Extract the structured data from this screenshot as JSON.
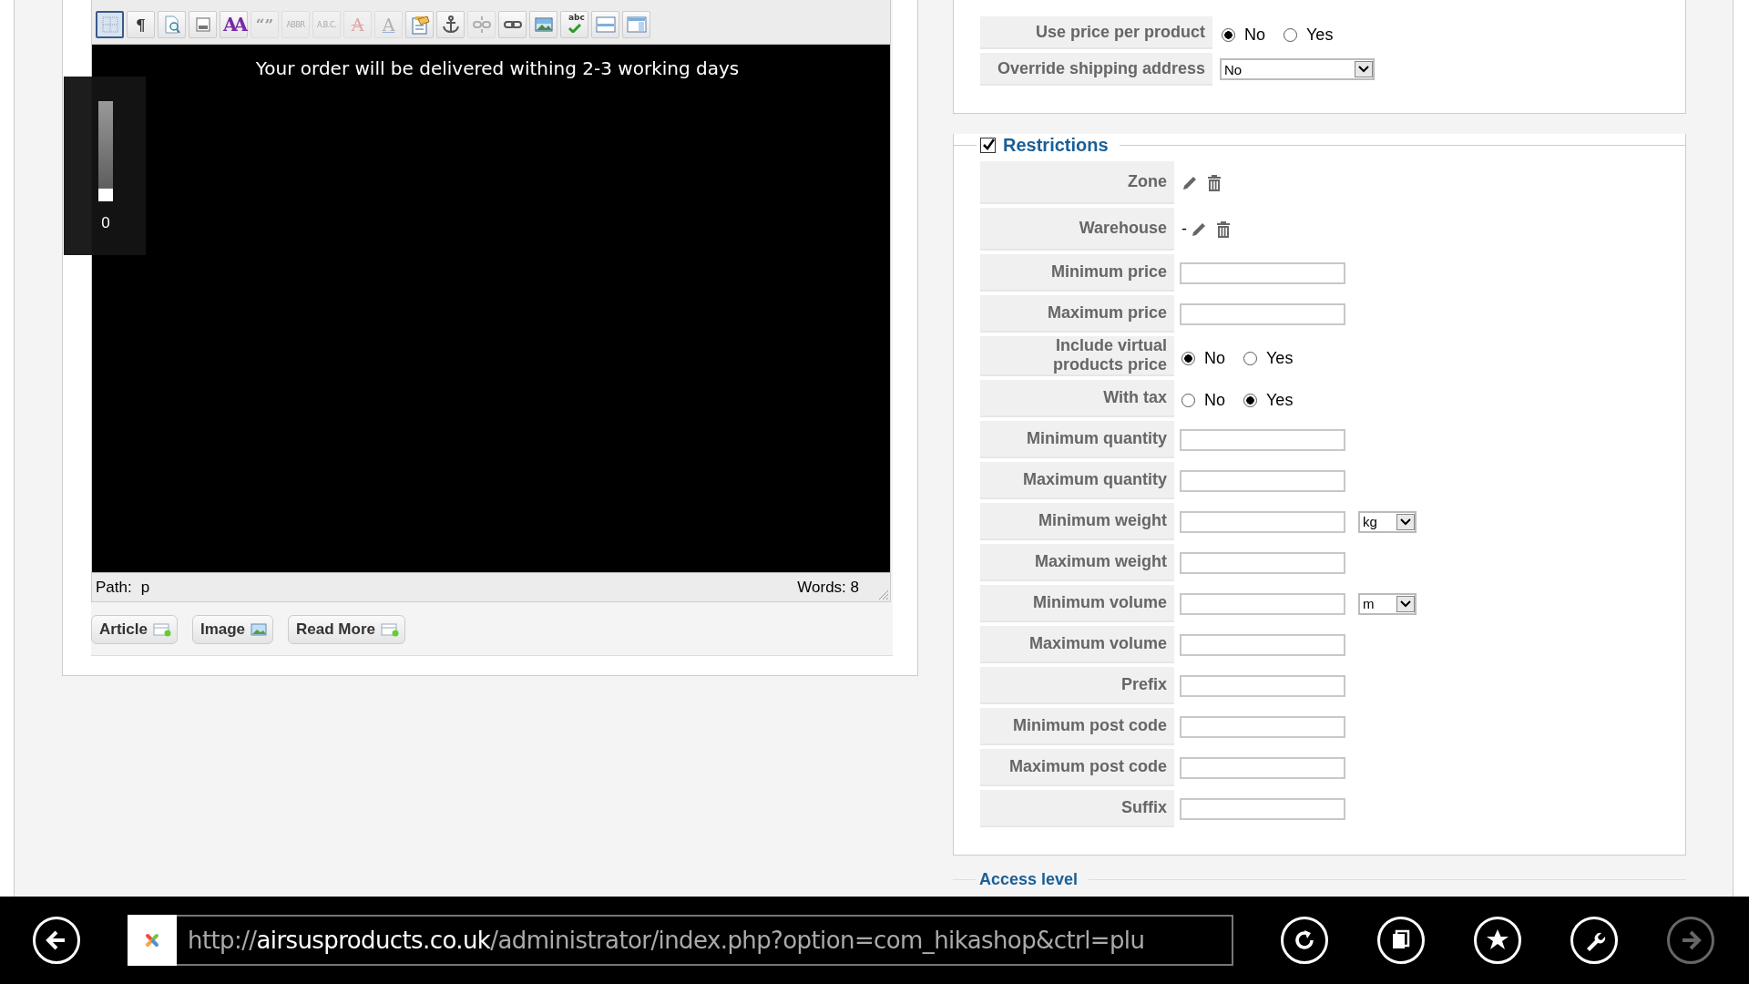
{
  "editor": {
    "toolbar": [
      {
        "kind": "grid",
        "selected": true,
        "disabled": false
      },
      {
        "kind": "glyph",
        "text": "¶",
        "selected": false,
        "disabled": false
      },
      {
        "kind": "preview",
        "selected": false,
        "disabled": false
      },
      {
        "kind": "template",
        "selected": false,
        "disabled": false
      },
      {
        "kind": "styled",
        "text": "AA",
        "selected": false,
        "disabled": false
      },
      {
        "kind": "glyph",
        "text": "“”",
        "selected": false,
        "disabled": true
      },
      {
        "kind": "small",
        "text": "ABBR",
        "selected": false,
        "disabled": true
      },
      {
        "kind": "small",
        "text": "A.B.C.",
        "selected": false,
        "disabled": true
      },
      {
        "kind": "strike",
        "text": "A",
        "selected": false,
        "disabled": true
      },
      {
        "kind": "underline",
        "text": "A",
        "selected": false,
        "disabled": true
      },
      {
        "kind": "paste",
        "selected": false,
        "disabled": false
      },
      {
        "kind": "anchor",
        "selected": false,
        "disabled": false
      },
      {
        "kind": "unlink",
        "selected": false,
        "disabled": true
      },
      {
        "kind": "link",
        "selected": false,
        "disabled": false
      },
      {
        "kind": "image",
        "selected": false,
        "disabled": false
      },
      {
        "kind": "spellcheck",
        "text": "abc",
        "selected": false,
        "disabled": false
      },
      {
        "kind": "rule",
        "selected": false,
        "disabled": false
      },
      {
        "kind": "layout",
        "selected": false,
        "disabled": false
      }
    ],
    "content": "Your order will be delivered withing 2-3 working days",
    "path_label": "Path:",
    "path": "p",
    "words": "Words: 8",
    "buttons": [
      {
        "label": "Article",
        "kind": "page"
      },
      {
        "label": "Image",
        "kind": "image"
      },
      {
        "label": "Read More",
        "kind": "page"
      }
    ]
  },
  "zoom_overlay": {
    "level": 0,
    "value": "0"
  },
  "shipping_options": {
    "rows": [
      {
        "kind": "radio",
        "label": "Use price per product",
        "options": [
          {
            "label": "No",
            "selected": true
          },
          {
            "label": "Yes",
            "selected": false
          }
        ]
      },
      {
        "kind": "select",
        "label": "Override shipping address",
        "value": "No"
      }
    ]
  },
  "restrictions": {
    "title": "Restrictions",
    "checked": true,
    "rows": [
      {
        "kind": "picker",
        "label": "Zone"
      },
      {
        "kind": "picker",
        "label": "Warehouse",
        "value": "-"
      },
      {
        "kind": "input",
        "label": "Minimum price"
      },
      {
        "kind": "input",
        "label": "Maximum price"
      },
      {
        "kind": "radio",
        "label": "Include virtual products price",
        "options": [
          {
            "label": "No",
            "selected": true
          },
          {
            "label": "Yes",
            "selected": false
          }
        ]
      },
      {
        "kind": "radio",
        "label": "With tax",
        "options": [
          {
            "label": "No",
            "selected": false
          },
          {
            "label": "Yes",
            "selected": true
          }
        ]
      },
      {
        "kind": "input",
        "label": "Minimum quantity"
      },
      {
        "kind": "input",
        "label": "Maximum quantity"
      },
      {
        "kind": "input",
        "label": "Minimum weight",
        "unit": "kg"
      },
      {
        "kind": "input",
        "label": "Maximum weight"
      },
      {
        "kind": "input",
        "label": "Minimum volume",
        "unit": "m"
      },
      {
        "kind": "input",
        "label": "Maximum volume"
      },
      {
        "kind": "input",
        "label": "Prefix"
      },
      {
        "kind": "input",
        "label": "Minimum post code"
      },
      {
        "kind": "input",
        "label": "Maximum post code"
      },
      {
        "kind": "input",
        "label": "Suffix"
      }
    ]
  },
  "access_level": {
    "title": "Access level"
  },
  "browser_bar": {
    "url": "http://**airsusproducts.co.uk**/administrator/index.php?option=com_hikashop&ctrl=plu",
    "buttons": [
      {
        "kind": "back",
        "disabled": false
      },
      {
        "kind": "refresh",
        "disabled": false
      },
      {
        "kind": "tabs",
        "disabled": false
      },
      {
        "kind": "star",
        "disabled": false
      },
      {
        "kind": "wrench",
        "disabled": false
      },
      {
        "kind": "forward",
        "disabled": true
      }
    ]
  }
}
